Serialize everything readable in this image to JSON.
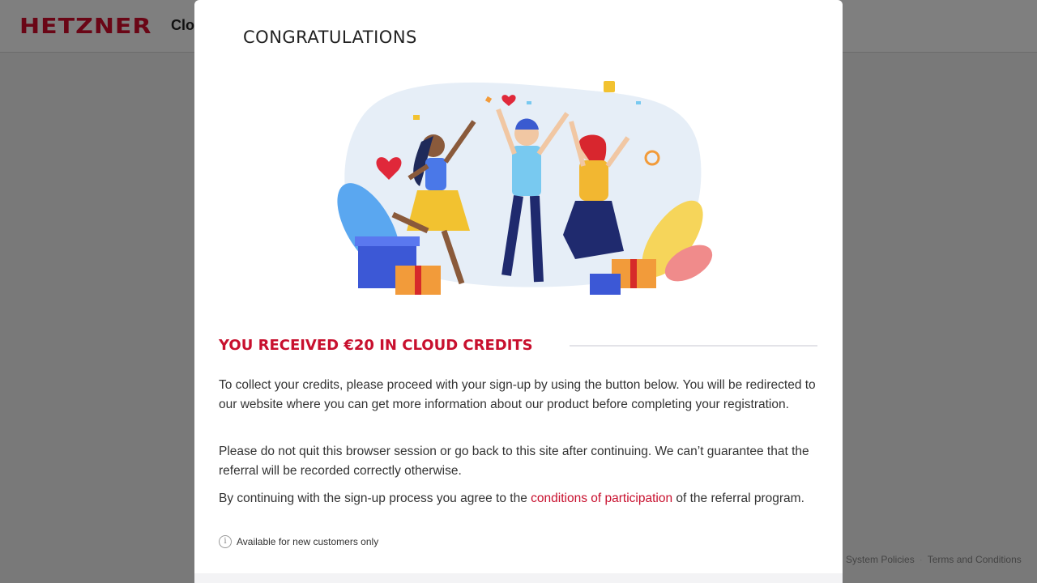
{
  "header": {
    "logo": "HETZNER",
    "brand_suffix": "Cloud"
  },
  "footer": {
    "links": [
      "System Policies",
      "Terms and Conditions"
    ],
    "separator": "·"
  },
  "modal": {
    "title": "CONGRATULATIONS",
    "illustration_icon": "celebration-illustration",
    "credit_heading": "YOU RECEIVED €20 IN CLOUD CREDITS",
    "paragraph1": "To collect your credits, please proceed with your sign-up by using the button below. You will be redirected to our website where you can get more information about our product before completing your registration.",
    "paragraph2": "Please do not quit this browser session or go back to this site after continuing. We can’t guarantee that the referral will be recorded correctly otherwise.",
    "paragraph3_pre": "By continuing with the sign-up process you agree to the ",
    "paragraph3_link": "conditions of participation",
    "paragraph3_post": " of the referral program.",
    "note_icon": "info-icon",
    "note": "Available for new customers only"
  },
  "colors": {
    "accent": "#c8102e",
    "overlay": "rgba(0,0,0,0.5)"
  }
}
